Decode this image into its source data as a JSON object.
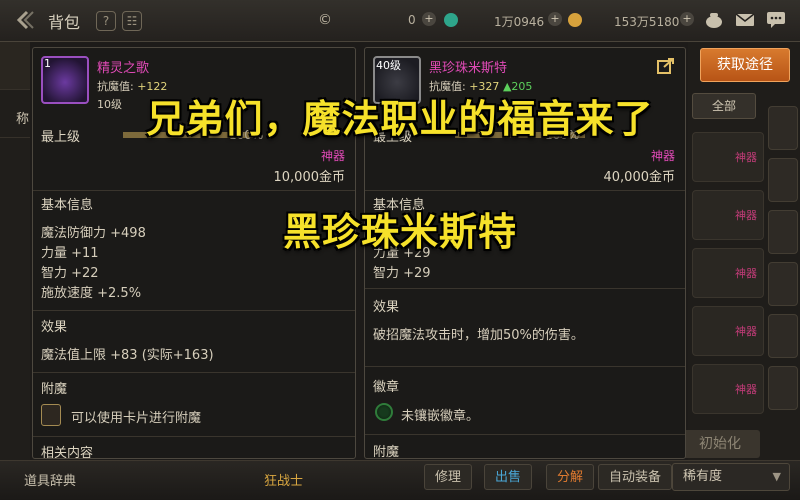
{
  "topbar": {
    "title": "背包",
    "currency_a": "0",
    "currency_b": "1万0946",
    "currency_c": "153万5180"
  },
  "left_card": {
    "level_badge": "1",
    "name": "精灵之歌",
    "resist_label": "抗魔值:",
    "resist_value": "+122",
    "sub_line": "10级",
    "level_label": "最上级",
    "percent": "100%",
    "progress": 1.0,
    "rarity": "神器",
    "price": "10,000金币",
    "basic_title": "基本信息",
    "stats": [
      "魔法防御力 +498",
      "力量 +11",
      "智力 +22",
      "施放速度 +2.5%"
    ],
    "effect_title": "效果",
    "effect_text": "魔法值上限 +83 (实际+163)",
    "enchant_title": "附魔",
    "enchant_text": "可以使用卡片进行附魔",
    "related_title": "相关内容"
  },
  "right_card": {
    "level_badge": "40级",
    "name": "黑珍珠米斯特",
    "resist_label": "抗魔值:",
    "resist_value": "+327",
    "resist_up": "▲205",
    "level_label": "最上级",
    "percent": "100%",
    "progress": 1.0,
    "rarity": "神器",
    "price": "40,000金币",
    "basic_title": "基本信息",
    "stats": [
      "力量 +29",
      "智力 +29"
    ],
    "effect_title": "效果",
    "effect_text": "破招魔法攻击时，增加50%的伤害。",
    "emblem_title": "徽章",
    "emblem_text": "未镶嵌徽章。",
    "enchant_title": "附魔"
  },
  "side": {
    "acquire_label": "获取途径",
    "filter_label": "全部",
    "item_label": "神器",
    "init_label": "初始化",
    "left_label": "称"
  },
  "bottombar": {
    "codex_label": "道具辞典",
    "class_label": "狂战士",
    "repair_label": "修理",
    "sell_label": "出售",
    "decompose_label": "分解",
    "auto_equip_label": "自动装备",
    "rarity_label": "稀有度"
  },
  "captions": {
    "main": "兄弟们，魔法职业的福音来了",
    "sub": "黑珍珠米斯特"
  },
  "colors": {
    "rarity_pink": "#e04ab6",
    "caption_yellow": "#f6e12a",
    "acquire_orange": "#d87a2e"
  }
}
